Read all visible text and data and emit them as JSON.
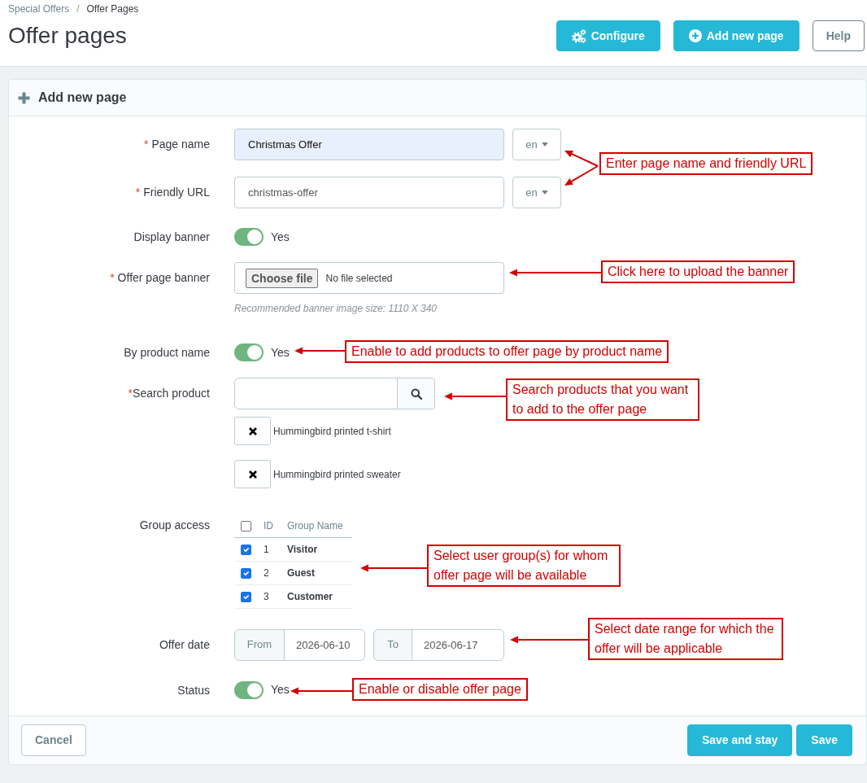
{
  "breadcrumb": {
    "items": [
      {
        "label": "Special Offers",
        "current": false
      },
      {
        "label": "Offer Pages",
        "current": true
      }
    ],
    "separator": "/"
  },
  "title": "Offer pages",
  "toolbar": [
    {
      "label": "Configure",
      "kind": "configure"
    },
    {
      "label": "Add new page",
      "kind": "add"
    },
    {
      "label": "Help",
      "kind": "plain"
    }
  ],
  "panel": {
    "title": "Add new page",
    "fields": [
      {
        "kind": "text",
        "required_mark": "*",
        "label": "Page name",
        "value": "Christmas Offer",
        "autofilled": true,
        "language": "en"
      },
      {
        "kind": "text",
        "required_mark": "*",
        "label": "Friendly URL",
        "value": "christmas-offer",
        "autofilled": false,
        "language": "en"
      },
      {
        "kind": "switch",
        "label": "Display banner",
        "on": true,
        "state_label": "Yes"
      },
      {
        "kind": "file",
        "required_mark": "*",
        "label": "Offer page banner",
        "button": "Choose file",
        "file": "No file selected",
        "help": "Recommended banner image size: 1110 X 340"
      },
      {
        "kind": "switch",
        "label": "By product name",
        "on": true,
        "state_label": "Yes"
      },
      {
        "kind": "search",
        "required_mark": "*",
        "label": "Search product",
        "products": [
          "Hummingbird printed t-shirt",
          "Hummingbird printed sweater"
        ]
      },
      {
        "kind": "groups",
        "label": "Group access",
        "select_all_checked": false,
        "columns": [
          "ID",
          "Group Name"
        ],
        "rows": [
          {
            "id": "1",
            "name": "Visitor",
            "checked": true
          },
          {
            "id": "2",
            "name": "Guest",
            "checked": true
          },
          {
            "id": "3",
            "name": "Customer",
            "checked": true
          }
        ]
      },
      {
        "kind": "daterange",
        "label": "Offer date",
        "from": {
          "label": "From",
          "value": "2026-06-10"
        },
        "to": {
          "label": "To",
          "value": "2026-06-17"
        }
      },
      {
        "kind": "switch",
        "label": "Status",
        "on": true,
        "state_label": "Yes"
      }
    ],
    "footer": {
      "cancel": "Cancel",
      "actions": [
        "Save and stay",
        "Save"
      ]
    }
  },
  "callouts": [
    {
      "text": "Enter page name and friendly URL"
    },
    {
      "text": "Click here to upload the banner"
    },
    {
      "text": "Enable to add products to offer page by product name"
    },
    {
      "text": "Search products that you want to add to the offer page"
    },
    {
      "text": "Select user group(s) for whom offer page will be available"
    },
    {
      "text": "Select date range for which the offer will be applicable"
    },
    {
      "text": "Enable or disable offer page"
    }
  ]
}
